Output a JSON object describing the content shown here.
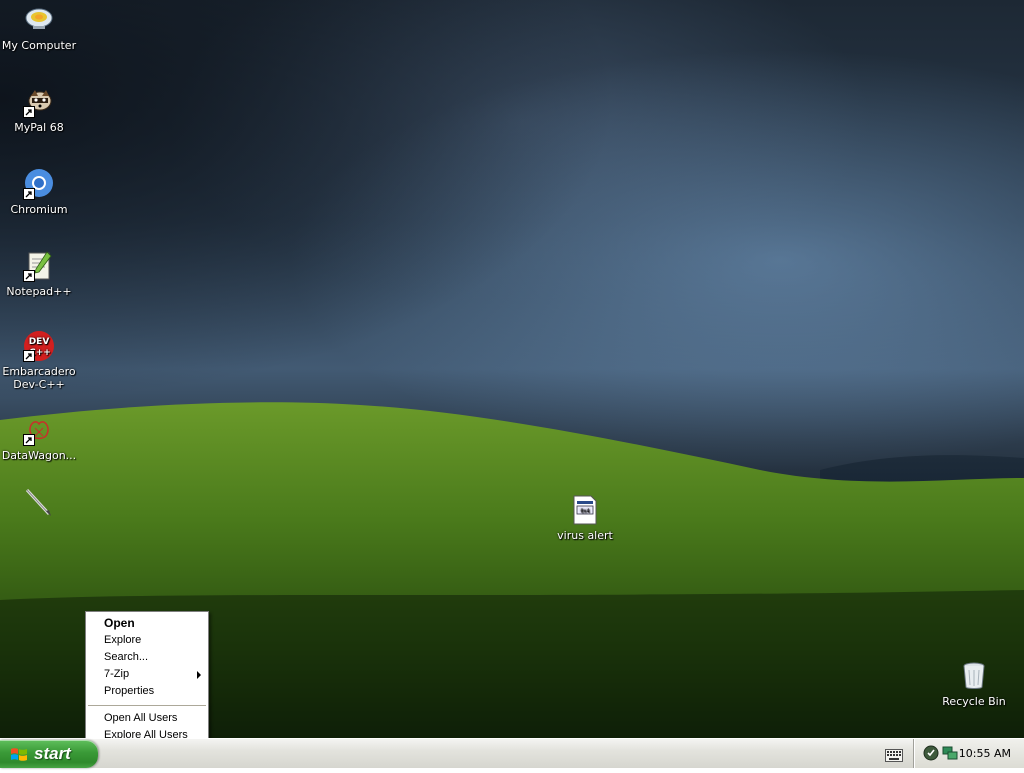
{
  "desktop": {
    "icons": [
      {
        "label": "My Computer",
        "icon": "my-computer-icon"
      },
      {
        "label": "MyPal 68",
        "icon": "mypal-browser-icon"
      },
      {
        "label": "Chromium",
        "icon": "chromium-icon"
      },
      {
        "label": "Notepad++",
        "icon": "notepad-plus-plus-icon"
      },
      {
        "label": "Embarcadero Dev-C++",
        "icon": "dev-cpp-icon"
      },
      {
        "label": "DataWagon...",
        "icon": "datawagon-icon"
      },
      {
        "label": "",
        "icon": "pen-tool-icon"
      },
      {
        "label": "virus alert",
        "icon": "text-document-icon"
      },
      {
        "label": "Recycle Bin",
        "icon": "recycle-bin-icon"
      }
    ]
  },
  "context_menu": {
    "items": [
      {
        "label": "Open",
        "bold": true
      },
      {
        "label": "Explore"
      },
      {
        "label": "Search..."
      },
      {
        "label": "7-Zip",
        "submenu": true
      },
      {
        "label": "Properties"
      },
      {
        "label": "Open All Users"
      },
      {
        "label": "Explore All Users"
      }
    ]
  },
  "taskbar": {
    "start_label": "start",
    "clock": "10:55 AM",
    "accent_color": "#3a9a37"
  }
}
